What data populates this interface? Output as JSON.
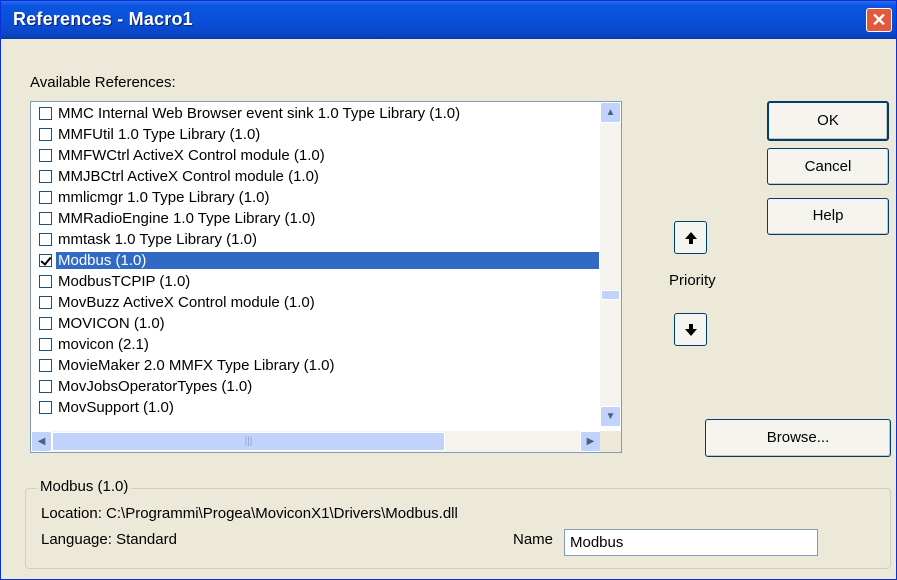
{
  "window": {
    "title": "References - Macro1",
    "close_glyph": "✕"
  },
  "available_label": "Available References:",
  "references": [
    {
      "label": "MMC Internal Web Browser event sink 1.0 Type Library (1.0)",
      "checked": false,
      "selected": false
    },
    {
      "label": "MMFUtil 1.0 Type Library (1.0)",
      "checked": false,
      "selected": false
    },
    {
      "label": "MMFWCtrl ActiveX Control module (1.0)",
      "checked": false,
      "selected": false
    },
    {
      "label": "MMJBCtrl ActiveX Control module (1.0)",
      "checked": false,
      "selected": false
    },
    {
      "label": "mmlicmgr 1.0 Type Library (1.0)",
      "checked": false,
      "selected": false
    },
    {
      "label": "MMRadioEngine 1.0 Type Library (1.0)",
      "checked": false,
      "selected": false
    },
    {
      "label": "mmtask 1.0 Type Library (1.0)",
      "checked": false,
      "selected": false
    },
    {
      "label": "Modbus (1.0)",
      "checked": true,
      "selected": true
    },
    {
      "label": "ModbusTCPIP (1.0)",
      "checked": false,
      "selected": false
    },
    {
      "label": "MovBuzz ActiveX Control module (1.0)",
      "checked": false,
      "selected": false
    },
    {
      "label": "MOVICON (1.0)",
      "checked": false,
      "selected": false
    },
    {
      "label": "movicon (2.1)",
      "checked": false,
      "selected": false
    },
    {
      "label": "MovieMaker 2.0 MMFX Type Library (1.0)",
      "checked": false,
      "selected": false
    },
    {
      "label": "MovJobsOperatorTypes (1.0)",
      "checked": false,
      "selected": false
    },
    {
      "label": "MovSupport (1.0)",
      "checked": false,
      "selected": false
    }
  ],
  "buttons": {
    "ok": "OK",
    "cancel": "Cancel",
    "help": "Help",
    "browse": "Browse..."
  },
  "priority_label": "Priority",
  "details": {
    "group_title": "Modbus (1.0)",
    "location": "Location: C:\\Programmi\\Progea\\MoviconX1\\Drivers\\Modbus.dll",
    "language": "Language: Standard",
    "name_label": "Name",
    "name_value": "Modbus"
  },
  "colors": {
    "selection": "#316ac5",
    "titlebar": "#0a4fd8",
    "dialog_bg": "#ece9d8"
  }
}
